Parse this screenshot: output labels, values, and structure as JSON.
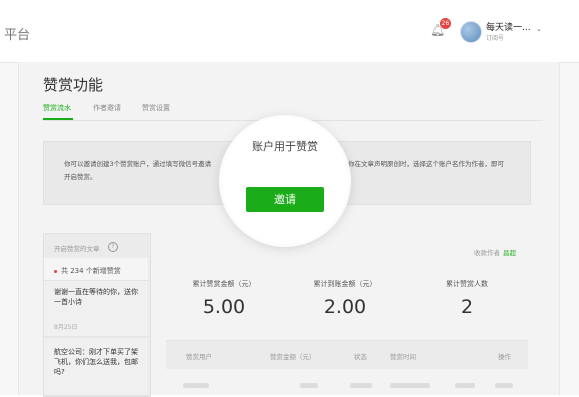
{
  "header": {
    "platform_fragment": "平台",
    "notification_count": "26",
    "account_name": "每天读一...",
    "account_type": "订阅号",
    "caret": "⌄"
  },
  "page": {
    "title": "赞赏功能",
    "tabs": [
      {
        "label": "赞赏流水",
        "active": true
      },
      {
        "label": "作者邀请",
        "active": false
      },
      {
        "label": "赞赏设置",
        "active": false
      }
    ]
  },
  "invite_info": {
    "line1_left": "你可以邀请创建3个赞赏账户，通过填写微信号邀请",
    "lens_text": "账户用于赞赏",
    "line1_right": "你在文章声明原创时，选择这个账户名作为作者，即可",
    "line2": "开启赞赏。",
    "button_label": "邀请"
  },
  "sidebar": {
    "header": "开启赞赏的文章",
    "help": "?",
    "new_count_text": "共 234 个新增赞赏",
    "article1": "谢谢一直在等待的你，送你一首小诗",
    "article1_date": "8月25日",
    "article2": "航空公司：刚才下单买了架飞机，你们怎么送我，包邮吗?"
  },
  "authors": {
    "label": "收款作者",
    "name": "昌超"
  },
  "stats": [
    {
      "label": "累计赞赏金额（元）",
      "value": "5.00"
    },
    {
      "label": "累计到账金额（元）",
      "value": "2.00"
    },
    {
      "label": "累计赞赏人数",
      "value": "2"
    }
  ],
  "table": {
    "headers": [
      "赞赏用户",
      "赞赏金额（元）",
      "状态",
      "赞赏时间",
      "操作"
    ]
  }
}
